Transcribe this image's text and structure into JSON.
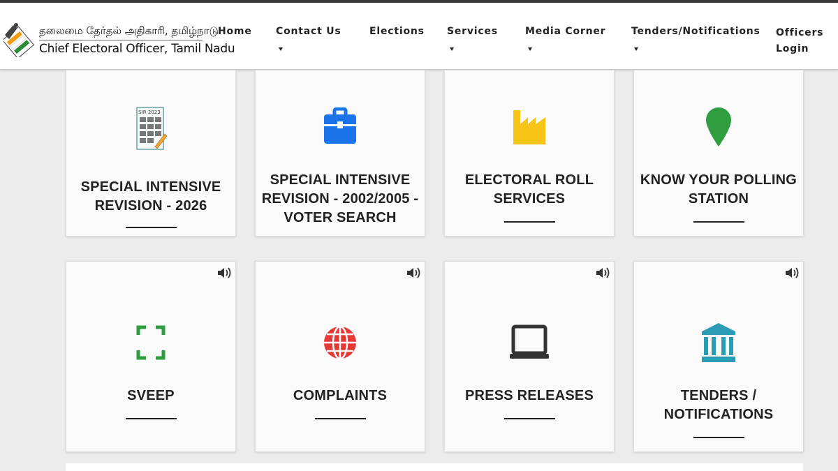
{
  "header": {
    "brand_tamil": "தலைமை தேர்தல் அதிகாரி, தமிழ்நாடு",
    "brand_english": "Chief Electoral Officer, Tamil Nadu",
    "nav": [
      {
        "label": "Home",
        "dropdown": false
      },
      {
        "label": "Contact Us",
        "dropdown": true
      },
      {
        "label": "Elections",
        "dropdown": false
      },
      {
        "label": "Services",
        "dropdown": true
      },
      {
        "label": "Media Corner",
        "dropdown": true
      },
      {
        "label": "Tenders/Notifications",
        "dropdown": true
      },
      {
        "label": "Officers Login",
        "dropdown": false
      }
    ]
  },
  "cards": [
    {
      "title": "SPECIAL INTENSIVE REVISION - 2026",
      "icon": "sir-2023-document-icon",
      "icon_text": "SIR 2023",
      "speaker": false
    },
    {
      "title": "SPECIAL INTENSIVE REVISION - 2002/2005 - VOTER SEARCH",
      "icon": "briefcase-icon",
      "speaker": false
    },
    {
      "title": "ELECTORAL ROLL SERVICES",
      "icon": "factory-icon",
      "speaker": false
    },
    {
      "title": "KNOW YOUR POLLING STATION",
      "icon": "map-pin-icon",
      "speaker": false
    },
    {
      "title": "SVEEP",
      "icon": "focus-frame-icon",
      "speaker": true
    },
    {
      "title": "COMPLAINTS",
      "icon": "globe-icon",
      "speaker": true
    },
    {
      "title": "PRESS RELEASES",
      "icon": "laptop-icon",
      "speaker": true
    },
    {
      "title": "TENDERS / NOTIFICATIONS",
      "icon": "bank-building-icon",
      "speaker": true
    }
  ],
  "colors": {
    "briefcase": "#1a73e8",
    "factory": "#f7c418",
    "map_pin": "#2e9e3f",
    "focus_frame": "#2e9e3f",
    "globe": "#e53935",
    "laptop": "#333333",
    "bank": "#2a9db5"
  }
}
